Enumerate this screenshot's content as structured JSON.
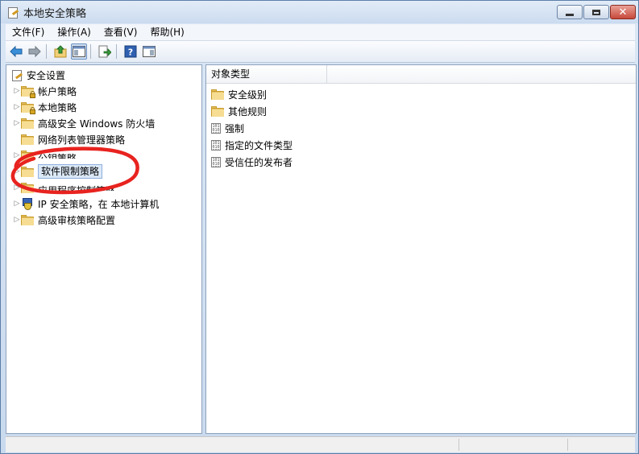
{
  "window": {
    "title": "本地安全策略",
    "close_glyph": "✕"
  },
  "menu": [
    {
      "label": "文件(F)"
    },
    {
      "label": "操作(A)"
    },
    {
      "label": "查看(V)"
    },
    {
      "label": "帮助(H)"
    }
  ],
  "toolbar": {
    "icons": [
      "back-arrow-icon",
      "forward-arrow-icon",
      "up-folder-icon",
      "show-hide-tree-icon",
      "export-list-icon",
      "help-icon",
      "properties-pane-icon"
    ]
  },
  "tree": {
    "root": "安全设置",
    "items": [
      {
        "label": "帐户策略",
        "icon": "folder-lock-icon",
        "expandable": true
      },
      {
        "label": "本地策略",
        "icon": "folder-lock-icon",
        "expandable": true
      },
      {
        "label": "高级安全 Windows 防火墙",
        "icon": "folder-icon",
        "expandable": true
      },
      {
        "label": "网络列表管理器策略",
        "icon": "folder-icon",
        "expandable": false
      },
      {
        "label": "公钥策略",
        "icon": "folder-icon",
        "expandable": true,
        "partially_hidden": true
      },
      {
        "label": "软件限制策略",
        "icon": "folder-icon",
        "expandable": true,
        "selected": true
      },
      {
        "label": "应用程序控制策略",
        "icon": "folder-icon",
        "expandable": true,
        "partially_hidden": true
      },
      {
        "label": "IP 安全策略，在 本地计算机",
        "icon": "ipsec-shield-icon",
        "expandable": true
      },
      {
        "label": "高级审核策略配置",
        "icon": "folder-icon",
        "expandable": true
      }
    ]
  },
  "list": {
    "column": "对象类型",
    "rows": [
      {
        "label": "安全级别",
        "icon": "folder-icon"
      },
      {
        "label": "其他规则",
        "icon": "folder-icon"
      },
      {
        "label": "强制",
        "icon": "policy-icon"
      },
      {
        "label": "指定的文件类型",
        "icon": "policy-icon"
      },
      {
        "label": "受信任的发布者",
        "icon": "policy-icon"
      }
    ]
  },
  "colors": {
    "annotation_circle": "#e8231f",
    "selection": "#dbe8f7"
  }
}
